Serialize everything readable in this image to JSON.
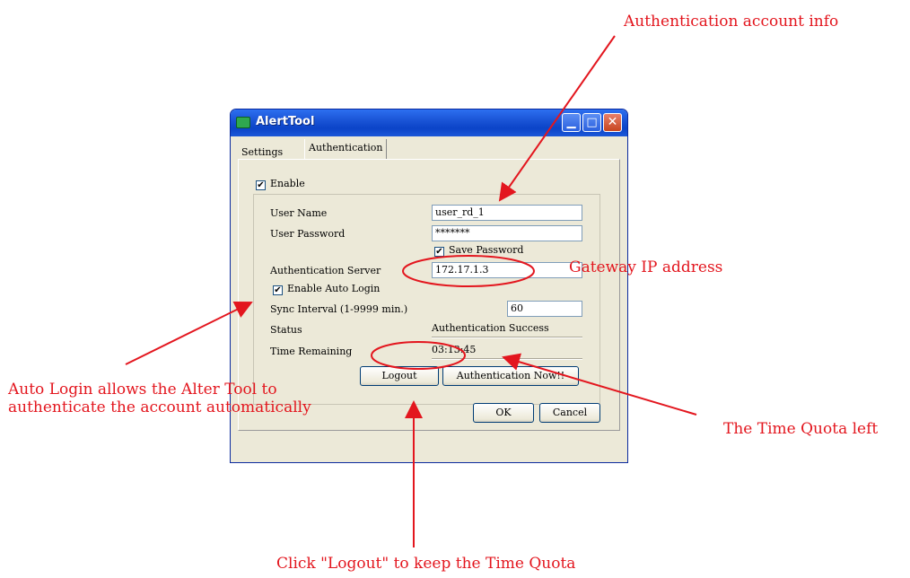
{
  "window": {
    "title": "AlertTool"
  },
  "tabs": {
    "settings": "Settings",
    "authentication": "Authentication"
  },
  "form": {
    "enable_label": "Enable",
    "enable_checked": "✔",
    "user_name_label": "User Name",
    "user_name_value": "user_rd_1",
    "password_label": "User Password",
    "password_value": "*******",
    "save_password_label": "Save Password",
    "save_password_checked": "✔",
    "server_label": "Authentication Server",
    "server_value": "172.17.1.3",
    "auto_login_label": "Enable Auto Login",
    "auto_login_checked": "✔",
    "sync_label": "Sync Interval (1-9999 min.)",
    "sync_value": "60",
    "status_label": "Status",
    "status_value": "Authentication Success",
    "time_label": "Time Remaining",
    "time_value": "03:13:45"
  },
  "buttons": {
    "logout": "Logout",
    "auth_now": "Authentication Now!!",
    "ok": "OK",
    "cancel": "Cancel"
  },
  "annotations": {
    "account_info": "Authentication account info",
    "gateway_ip": "Gateway IP address",
    "auto_login_line1": "Auto Login allows the Alter Tool to",
    "auto_login_line2": "authenticate the account automatically",
    "time_quota": "The Time Quota left",
    "logout_tip": "Click \"Logout\" to keep the Time Quota"
  },
  "colors": {
    "annotation": "#e3161e",
    "titlebar": "#0b44c8"
  }
}
